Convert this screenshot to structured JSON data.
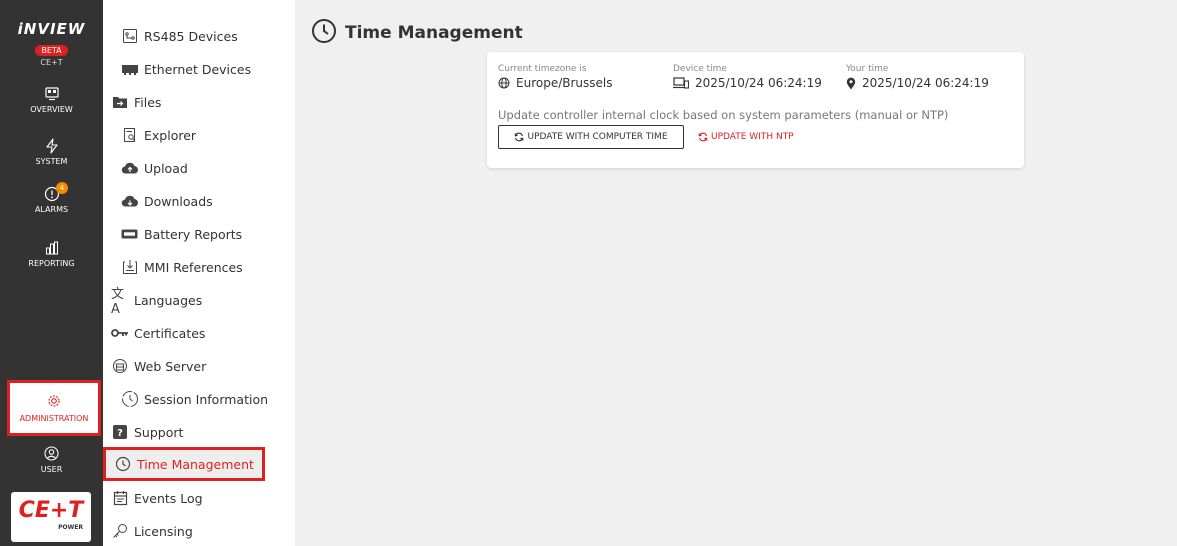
{
  "brand": {
    "name": "iNVIEW",
    "badge": "BETA",
    "sub": "CE+T"
  },
  "rail": {
    "overview": "OVERVIEW",
    "system": "SYSTEM",
    "alarms": "ALARMS",
    "alarm_count": "4",
    "reporting": "REPORTING",
    "administration": "ADMINISTRATION",
    "user": "USER"
  },
  "logo": {
    "mark": "CE+T",
    "sub": "POWER"
  },
  "submenu": {
    "items": [
      {
        "label": "RS485 Devices",
        "icon": "rs485-icon"
      },
      {
        "label": "Ethernet Devices",
        "icon": "ethernet-icon"
      },
      {
        "label": "Files",
        "icon": "files-icon"
      },
      {
        "label": "Explorer",
        "icon": "explorer-icon"
      },
      {
        "label": "Upload",
        "icon": "upload-icon"
      },
      {
        "label": "Downloads",
        "icon": "download-icon"
      },
      {
        "label": "Battery Reports",
        "icon": "battery-icon"
      },
      {
        "label": "MMI References",
        "icon": "mmi-icon"
      },
      {
        "label": "Languages",
        "icon": "translate-icon"
      },
      {
        "label": "Certificates",
        "icon": "key-icon"
      },
      {
        "label": "Web Server",
        "icon": "webserver-icon"
      },
      {
        "label": "Session Information",
        "icon": "session-icon"
      },
      {
        "label": "Support",
        "icon": "help-icon"
      },
      {
        "label": "Time Management",
        "icon": "clock-icon"
      },
      {
        "label": "Events Log",
        "icon": "calendar-icon"
      },
      {
        "label": "Licensing",
        "icon": "licence-key-icon"
      }
    ]
  },
  "page": {
    "title": "Time Management"
  },
  "card": {
    "timezone_label": "Current timezone is",
    "timezone_value": "Europe/Brussels",
    "device_time_label": "Device time",
    "device_time_value": "2025/10/24 06:24:19",
    "your_time_label": "Your time",
    "your_time_value": "2025/10/24 06:24:19",
    "description": "Update controller internal clock based on system parameters (manual or NTP)",
    "btn_computer": "UPDATE WITH COMPUTER TIME",
    "btn_ntp": "UPDATE WITH NTP"
  },
  "colors": {
    "accent": "#e02020",
    "rail_bg": "#333333",
    "alarm_badge": "#f08c00"
  }
}
